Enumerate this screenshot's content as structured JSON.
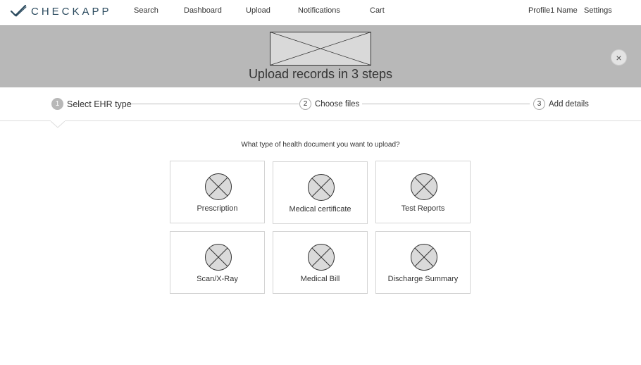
{
  "brand": {
    "name": "CHECKAPP"
  },
  "nav": {
    "items": [
      "Search",
      "Dashboard",
      "Upload",
      "Notifications",
      "Cart"
    ],
    "profile": "Profile1 Name",
    "settings": "Settings"
  },
  "hero": {
    "title": "Upload records in 3 steps",
    "close_label": "×"
  },
  "stepper": {
    "steps": [
      {
        "number": "1",
        "label": "Select EHR type",
        "active": true
      },
      {
        "number": "2",
        "label": "Choose files",
        "active": false
      },
      {
        "number": "3",
        "label": "Add details",
        "active": false
      }
    ]
  },
  "main": {
    "question": "What type of health document you want to upload?",
    "options": [
      {
        "label": "Prescription",
        "icon": "image-placeholder-icon"
      },
      {
        "label": "Medical certificate",
        "icon": "image-placeholder-icon"
      },
      {
        "label": "Test Reports",
        "icon": "image-placeholder-icon"
      },
      {
        "label": "Scan/X-Ray",
        "icon": "image-placeholder-icon"
      },
      {
        "label": "Medical Bill",
        "icon": "image-placeholder-icon"
      },
      {
        "label": "Discharge Summary",
        "icon": "image-placeholder-icon"
      }
    ]
  },
  "colors": {
    "brand": "#2a4a5e",
    "hero_bg": "#b8b8b8",
    "active_step": "#b8b8b8"
  }
}
